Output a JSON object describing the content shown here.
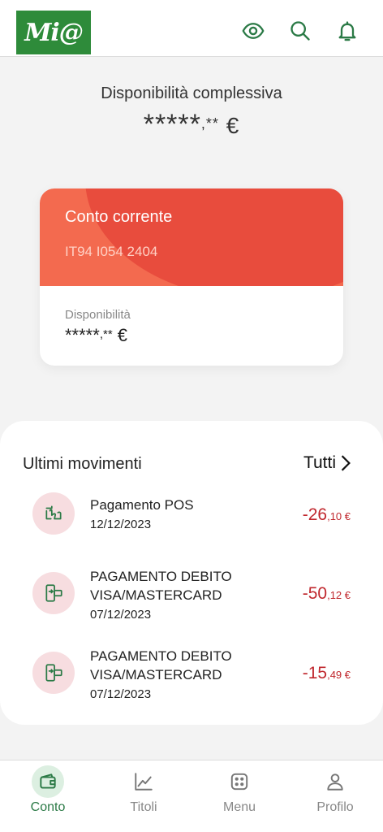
{
  "header": {
    "logo_text": "Mi@",
    "icons": [
      "eye-icon",
      "search-icon",
      "bell-icon"
    ],
    "brand_color": "#2e8b3a"
  },
  "summary": {
    "label": "Disponibilità complessiva",
    "masked_integer": "*****",
    "masked_decimal": ",**",
    "currency": "€"
  },
  "account_card": {
    "title": "Conto corrente",
    "iban": "IT94 I054 2404",
    "available_label": "Disponibilità",
    "masked_integer": "*****",
    "masked_decimal": ",**",
    "currency": "€",
    "colors": {
      "primary": "#f36a4f",
      "secondary": "#e84c3d"
    }
  },
  "movements": {
    "title": "Ultimi movimenti",
    "all_label": "Tutti",
    "items": [
      {
        "icon": "pos-payment-icon",
        "line1": "Pagamento POS",
        "line2": "",
        "date": "12/12/2023",
        "amount_int": "-26",
        "amount_dec": ",10 €"
      },
      {
        "icon": "card-transfer-icon",
        "line1": "PAGAMENTO DEBITO",
        "line2": "VISA/MASTERCARD",
        "date": "07/12/2023",
        "amount_int": "-50",
        "amount_dec": ",12 €"
      },
      {
        "icon": "card-transfer-icon",
        "line1": "PAGAMENTO DEBITO",
        "line2": "VISA/MASTERCARD",
        "date": "07/12/2023",
        "amount_int": "-15",
        "amount_dec": ",49 €"
      }
    ],
    "negative_color": "#c0272d"
  },
  "nav": {
    "items": [
      {
        "label": "Conto",
        "icon": "wallet-icon",
        "active": true
      },
      {
        "label": "Titoli",
        "icon": "chart-line-icon",
        "active": false
      },
      {
        "label": "Menu",
        "icon": "dice-grid-icon",
        "active": false
      },
      {
        "label": "Profilo",
        "icon": "user-icon",
        "active": false
      }
    ],
    "active_color": "#2b7a46"
  }
}
